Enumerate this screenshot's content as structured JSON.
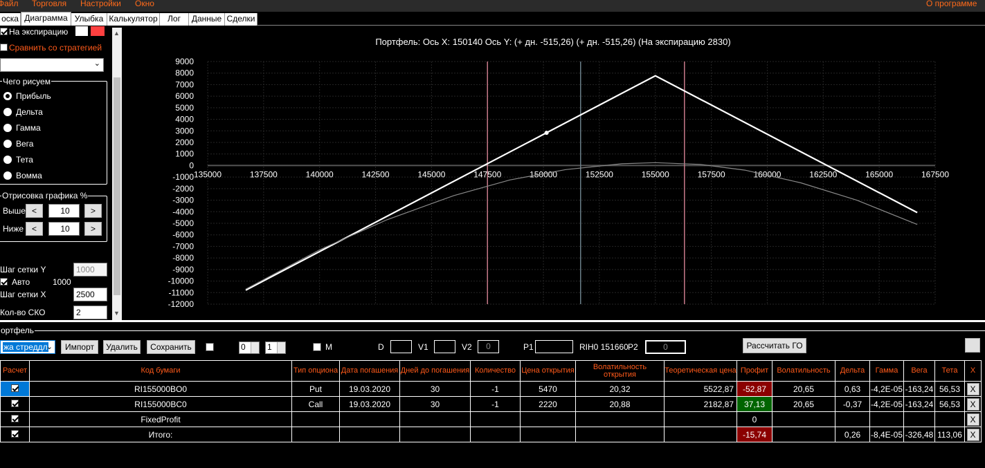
{
  "menu": {
    "file": "Файл",
    "trading": "Торговля",
    "settings": "Настройки",
    "window": "Окно",
    "about": "О программе"
  },
  "tabs": [
    "оска",
    "Диаграмма",
    "Улыбка",
    "Калькулятор",
    "Лог",
    "Данные",
    "Сделки"
  ],
  "active_tab": "Диаграмма",
  "left": {
    "expiration_label": "На экспирацию",
    "expiration_checked": true,
    "compare_label": "Сравнить со стратегией",
    "compare_checked": false,
    "strategy_select": "",
    "what_group": "Чего рисуем",
    "radios": [
      "Прибыль",
      "Дельта",
      "Гамма",
      "Вега",
      "Тета",
      "Вомма"
    ],
    "selected_radio": "Прибыль",
    "render_group": "Отрисовка графика %",
    "above_label": "Выше",
    "below_label": "Ниже",
    "above_value": "10",
    "below_value": "10",
    "arrow_left": "<",
    "arrow_right": ">",
    "grid_y_label": "Шаг сетки Y",
    "grid_y_value": "1000",
    "auto_label": "Авто",
    "auto_checked": true,
    "auto_value": "1000",
    "grid_x_label": "Шаг сетки X",
    "grid_x_value": "2500",
    "sko_label": "Кол-во СКО",
    "sko_value": "2"
  },
  "chart_data": {
    "type": "line",
    "title": "Портфель: Ось X: 150140 Ось Y: (+ дн. -515,26) (+ дн. -515,26) (На экспирацию 2830)",
    "xlim": [
      135000,
      167500
    ],
    "ylim": [
      -12000,
      9000
    ],
    "x_ticks": [
      "135000",
      "137500",
      "140000",
      "142500",
      "145000",
      "147500",
      "150000",
      "152500",
      "155000",
      "157500",
      "160000",
      "162500",
      "165000",
      "167500"
    ],
    "y_ticks": [
      "9000",
      "8000",
      "7000",
      "6000",
      "5000",
      "4000",
      "3000",
      "2000",
      "1000",
      "0",
      "-1000",
      "-2000",
      "-3000",
      "-4000",
      "-5000",
      "-6000",
      "-7000",
      "-8000",
      "-9000",
      "-10000",
      "-11000",
      "-12000"
    ],
    "grid": true,
    "series": [
      {
        "kind": "expiration",
        "color": "#ffffff",
        "x": [
          136700,
          155000,
          166700
        ],
        "y": [
          -10790,
          7770,
          -4070
        ]
      },
      {
        "kind": "current",
        "color": "#8a8a8a",
        "x": [
          136700,
          140000,
          143000,
          146000,
          148500,
          151000,
          153500,
          155000,
          157000,
          159000,
          161500,
          164000,
          166700
        ],
        "y": [
          -10700,
          -7300,
          -4700,
          -2600,
          -1250,
          -350,
          150,
          250,
          100,
          -400,
          -1500,
          -3000,
          -5100
        ]
      }
    ],
    "current_point": {
      "x": 150140,
      "y": 2830
    },
    "vertical_lines": [
      {
        "x": 147500,
        "color": "#c87a8a"
      },
      {
        "x": 151660,
        "color": "#6a7f8a"
      },
      {
        "x": 156300,
        "color": "#c87a8a"
      }
    ]
  },
  "portfolio": {
    "group_label": "ортфель",
    "strategy_select": "жа стреддл",
    "import": "Импорт",
    "delete": "Удалить",
    "save": "Сохранить",
    "spin1": "0",
    "spin2": "1",
    "m_label": "M",
    "d_label": "D",
    "v1_label": "V1",
    "v2_label": "V2",
    "v2_value": "0",
    "p1_label": "P1",
    "instrument": "RIH0 151660",
    "p2_label": "P2",
    "p2_value": "0",
    "calc_go": "Рассчитать ГО"
  },
  "table": {
    "headers": [
      "Расчет",
      "Код бумаги",
      "Тип опциона",
      "Дата погашения",
      "Дней до погашения",
      "Количество",
      "Цена открытия",
      "Волатильность открытия",
      "Теоретическая цена",
      "Профит",
      "Волатильность",
      "Дельта",
      "Гамма",
      "Вега",
      "Тета",
      "X"
    ],
    "rows": [
      {
        "code": "RI155000BO0",
        "type": "Put",
        "date": "19.03.2020",
        "days": "30",
        "qty": "-1",
        "open": "5470",
        "vol_open": "20,32",
        "theo": "5522,87",
        "profit": "-52,87",
        "vol": "20,65",
        "delta": "0,63",
        "gamma": "-4,2E-05",
        "vega": "-163,24",
        "theta": "56,53",
        "x": "X"
      },
      {
        "code": "RI155000BC0",
        "type": "Call",
        "date": "19.03.2020",
        "days": "30",
        "qty": "-1",
        "open": "2220",
        "vol_open": "20,88",
        "theo": "2182,87",
        "profit": "37,13",
        "vol": "20,65",
        "delta": "-0,37",
        "gamma": "-4,2E-05",
        "vega": "-163,24",
        "theta": "56,53",
        "x": "X"
      },
      {
        "code": "FixedProfit",
        "type": "",
        "date": "",
        "days": "",
        "qty": "",
        "open": "",
        "vol_open": "",
        "theo": "",
        "profit": "0",
        "vol": "",
        "delta": "",
        "gamma": "",
        "vega": "",
        "theta": "",
        "x": "X"
      },
      {
        "code": "Итого:",
        "type": "",
        "date": "",
        "days": "",
        "qty": "",
        "open": "",
        "vol_open": "",
        "theo": "",
        "profit": "-15,74",
        "vol": "",
        "delta": "0,26",
        "gamma": "-8,4E-05",
        "vega": "-326,48",
        "theta": "113,06",
        "x": "X"
      }
    ]
  }
}
